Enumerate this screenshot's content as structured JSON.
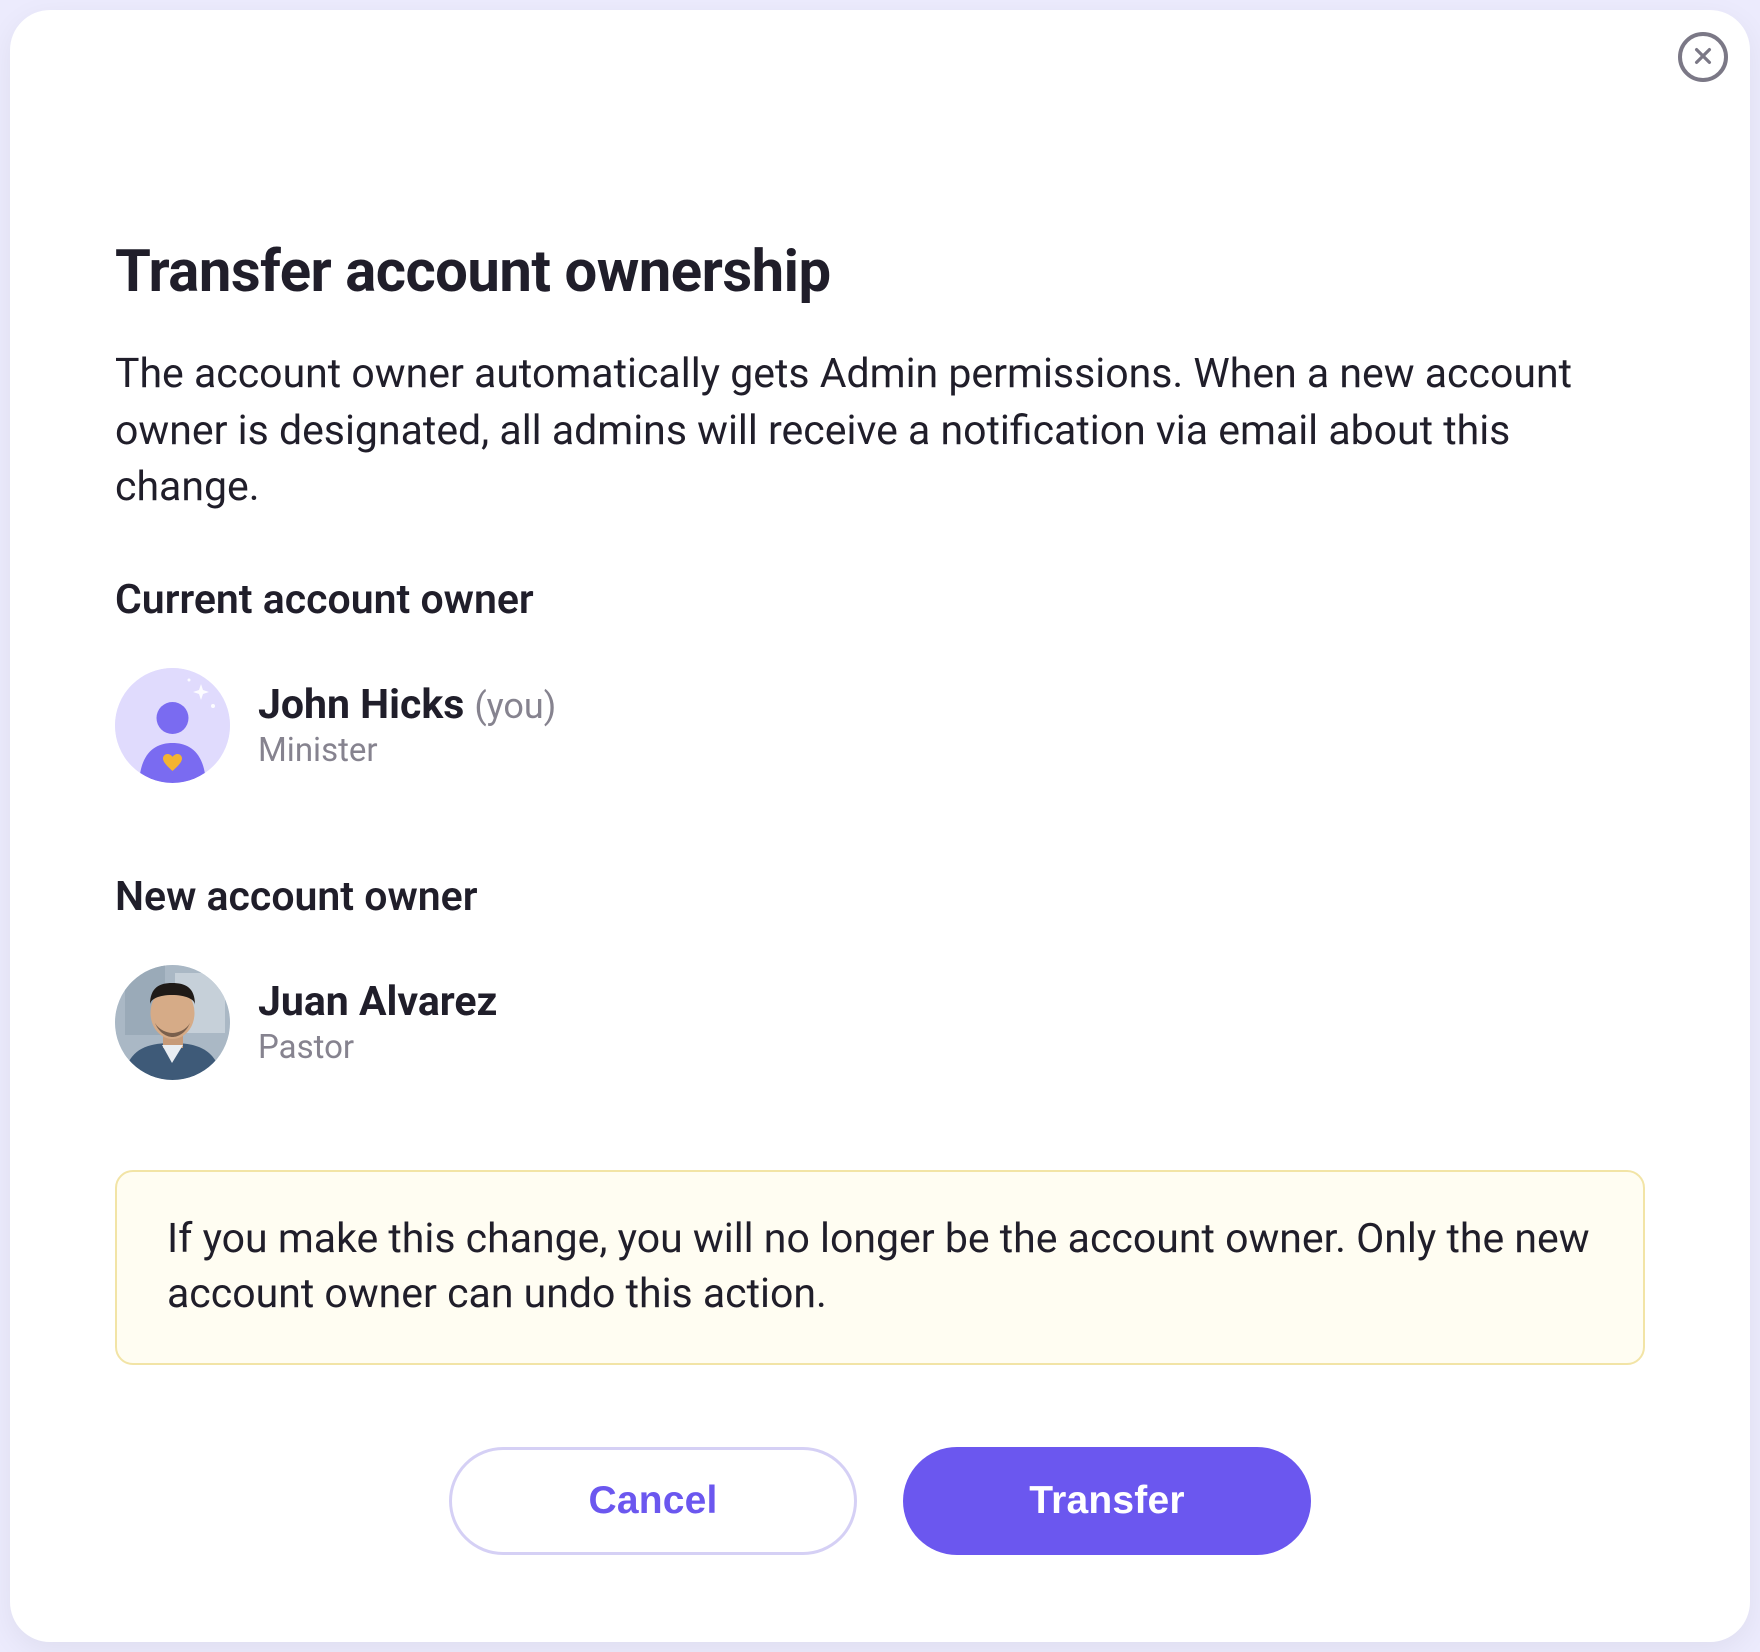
{
  "modal": {
    "title": "Transfer account ownership",
    "description": "The account owner automatically gets Admin permissions. When a new account owner is designated, all admins will receive a notification via email about this change.",
    "current_label": "Current account owner",
    "new_label": "New account owner",
    "current_owner": {
      "name": "John Hicks",
      "you_suffix": "(you)",
      "role": "Minister"
    },
    "new_owner": {
      "name": "Juan Alvarez",
      "role": "Pastor"
    },
    "warning": "If you make this change, you will no longer be the account owner. Only the new account owner can undo this action.",
    "buttons": {
      "cancel": "Cancel",
      "transfer": "Transfer"
    }
  }
}
